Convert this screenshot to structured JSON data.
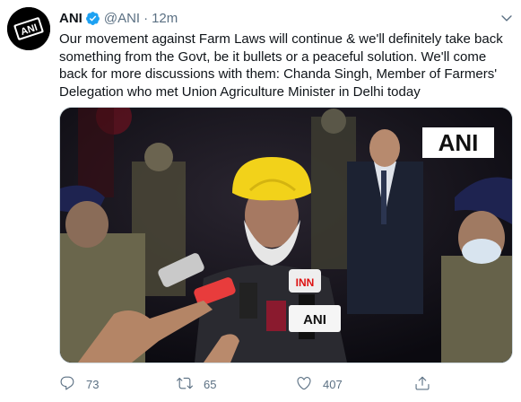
{
  "tweet": {
    "author_name": "ANI",
    "handle": "@ANI",
    "separator": "·",
    "time": "12m",
    "avatar_text": "ANI",
    "text": "Our movement against Farm Laws will continue & we'll definitely take back something from the Govt, be it bullets or a peaceful solution. We'll come back for more discussions with them: Chanda Singh, Member of Farmers' Delegation who met Union Agriculture Minister in Delhi today",
    "media": {
      "watermark": "ANI",
      "mic_labels": [
        "INN",
        "ANI"
      ]
    },
    "actions": {
      "replies": "73",
      "retweets": "65",
      "likes": "407"
    }
  },
  "colors": {
    "text": "#0f1419",
    "secondary": "#5b7083",
    "verified": "#1da1f2",
    "turban": "#f2d21a"
  }
}
